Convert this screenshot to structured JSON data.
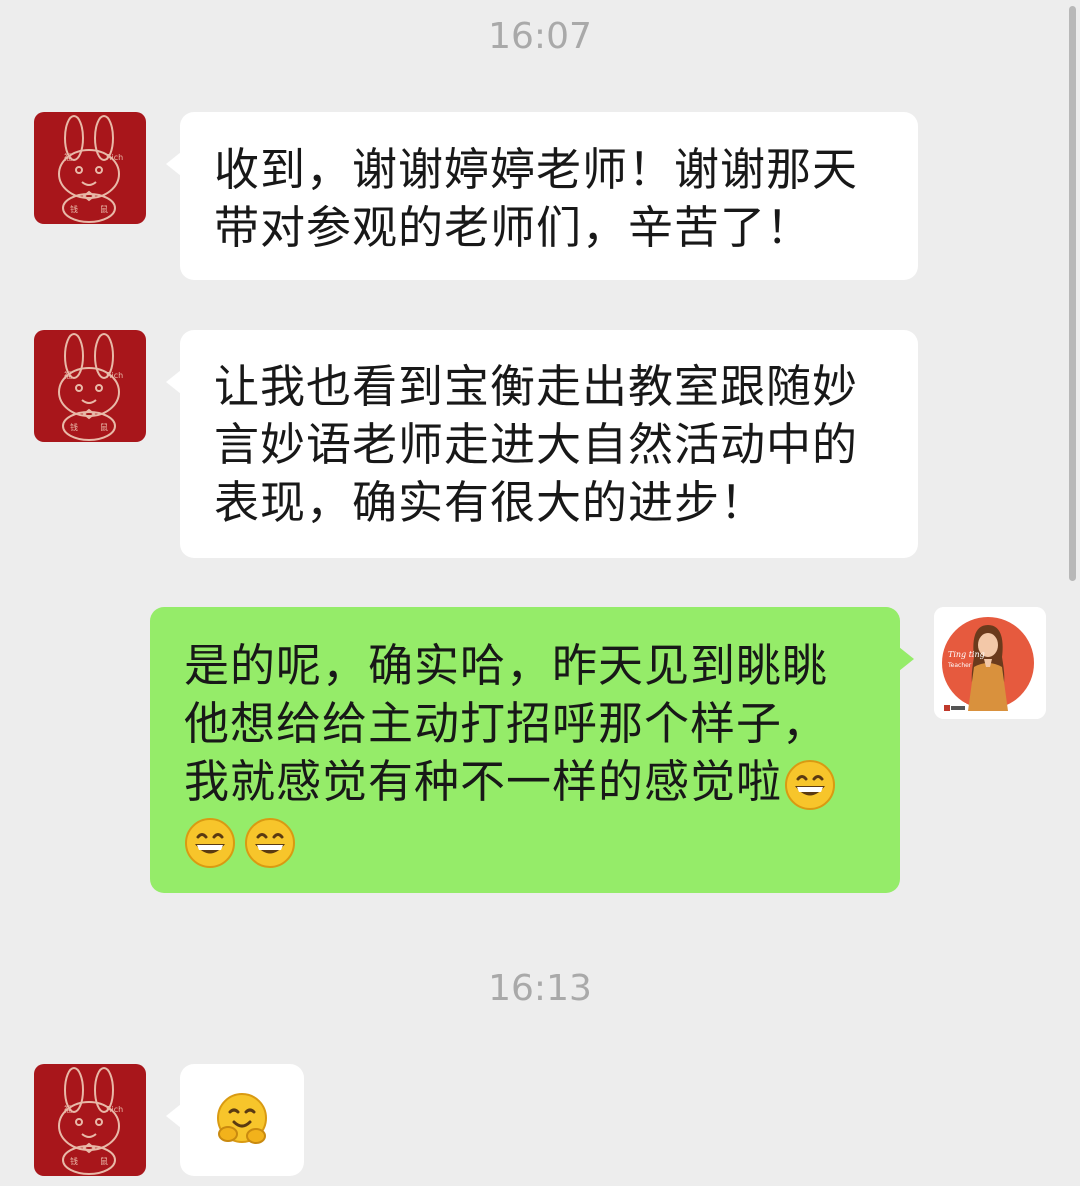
{
  "timestamps": [
    "16:07",
    "16:13"
  ],
  "messages": [
    {
      "side": "incoming",
      "lines": [
        "收到，谢谢婷婷老师！谢谢那天",
        "带对参观的老师们，辛苦了！"
      ]
    },
    {
      "side": "incoming",
      "lines": [
        "让我也看到宝衡走出教室跟随妙",
        "言妙语老师走进大自然活动中的",
        "表现，确实有很大的进步！"
      ]
    },
    {
      "side": "outgoing",
      "lines": [
        "是的呢，确实哈，昨天见到眺眺",
        "他想给给主动打招呼那个样子，",
        "我就感觉有种不一样的感觉啦"
      ],
      "emoji": [
        "grinning-emoji",
        "grinning-emoji",
        "grinning-emoji"
      ]
    },
    {
      "side": "incoming",
      "emoji": [
        "hugging-emoji"
      ]
    }
  ],
  "avatars": {
    "contact": "red-rabbit-avatar",
    "self": "teacher-avatar",
    "self_caption": "Ting ting Teacher"
  },
  "colors": {
    "background": "#ededed",
    "incoming_bubble": "#ffffff",
    "outgoing_bubble": "#95ec69",
    "avatar_red": "#a8161b"
  }
}
